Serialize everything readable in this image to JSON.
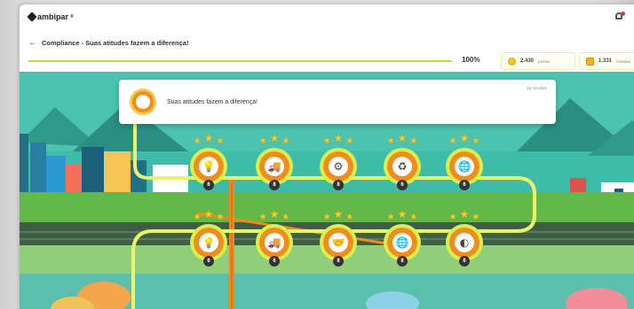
{
  "app": {
    "logo_text": "ambipar",
    "logo_mark": "®"
  },
  "breadcrumb": {
    "back_icon": "arrow-left-icon",
    "title": "Compliance - Suas atitudes fazem a diferença!"
  },
  "progress": {
    "value": 1.0,
    "label": "100%"
  },
  "stats": {
    "points": {
      "value": "2.430",
      "label": "pontos",
      "icon": "coin-icon"
    },
    "coins": {
      "value": "1.331",
      "label": "moedas",
      "icon": "gem-icon"
    }
  },
  "mission": {
    "title": "Suas atitudes fazem a diferença!",
    "meta": "18 missões"
  },
  "levels": [
    {
      "number": "6",
      "icon": "lightbulb-icon",
      "glyph": "💡",
      "stars": 3
    },
    {
      "number": "8",
      "icon": "truck-icon",
      "glyph": "🚚",
      "stars": 3
    },
    {
      "number": "8",
      "icon": "gears-icon",
      "glyph": "⚙",
      "stars": 3
    },
    {
      "number": "6",
      "icon": "recycle-icon",
      "glyph": "♻",
      "stars": 3
    },
    {
      "number": "6",
      "icon": "globe-icon",
      "glyph": "🌐",
      "stars": 3
    },
    {
      "number": "6",
      "icon": "lightbulb-icon",
      "glyph": "💡",
      "stars": 3
    },
    {
      "number": "6",
      "icon": "truck-icon",
      "glyph": "🚚",
      "stars": 3
    },
    {
      "number": "8",
      "icon": "handshake-icon",
      "glyph": "🤝",
      "stars": 3
    },
    {
      "number": "8",
      "icon": "globe-icon",
      "glyph": "🌐",
      "stars": 3
    },
    {
      "number": "6",
      "icon": "toggle-icon",
      "glyph": "◐",
      "stars": 3
    }
  ],
  "colors": {
    "accent": "#b7e03a",
    "badge_orange": "#f28c1c",
    "ring_lime": "#d8f04f",
    "star": "#f7c82a",
    "sky": "#36b7a3",
    "ground": "#63b84a"
  }
}
